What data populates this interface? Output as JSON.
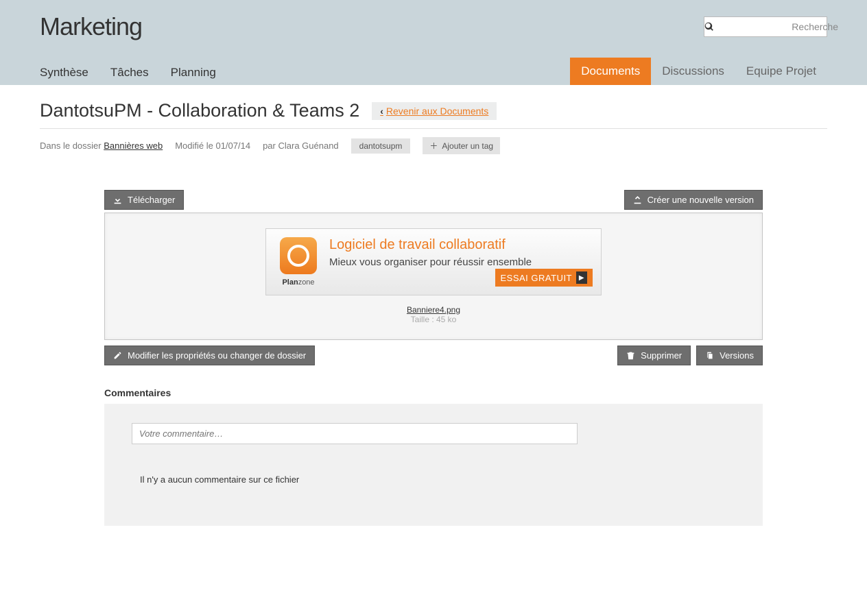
{
  "app_title": "Marketing",
  "search": {
    "placeholder": "Recherche"
  },
  "nav": {
    "left": [
      "Synthèse",
      "Tâches",
      "Planning"
    ],
    "right": [
      "Documents",
      "Discussions",
      "Equipe Projet"
    ],
    "active_right": "Documents"
  },
  "page": {
    "title": "DantotsuPM - Collaboration & Teams 2",
    "back_label": " Revenir aux Documents"
  },
  "meta": {
    "folder_prefix": "Dans le dossier ",
    "folder_name": "Bannières web",
    "modified": "Modifié le 01/07/14",
    "author": "par Clara Guénand",
    "tag": "dantotsupm",
    "add_tag": "Ajouter un tag"
  },
  "buttons": {
    "download": "Télécharger",
    "new_version": "Créer une nouvelle version",
    "modify": "Modifier les propriétés ou changer de dossier",
    "delete": "Supprimer",
    "versions": "Versions"
  },
  "banner": {
    "brand_prefix": "Plan",
    "brand_suffix": "zone",
    "headline": "Logiciel de travail collaboratif",
    "subline": "Mieux vous organiser pour réussir ensemble",
    "cta": "ESSAI GRATUIT"
  },
  "file": {
    "name": "Banniere4.png",
    "size": "Taille : 45 ko"
  },
  "comments": {
    "title": "Commentaires",
    "placeholder": "Votre commentaire…",
    "empty": "Il n'y a aucun commentaire sur ce fichier"
  }
}
